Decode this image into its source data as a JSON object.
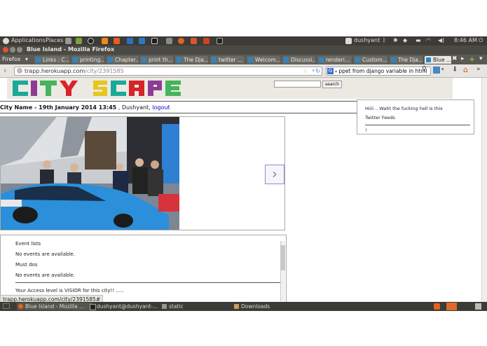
{
  "top_panel": {
    "applications": "Applications",
    "places": "Places",
    "user": "dushyant",
    "time": "8:46 AM"
  },
  "window": {
    "title": "Blue Island - Mozilla Firefox"
  },
  "firefox_menu": "Firefox",
  "tabs": [
    {
      "label": "Links : C..."
    },
    {
      "label": "printing..."
    },
    {
      "label": "Chapter..."
    },
    {
      "label": "print th..."
    },
    {
      "label": "The Dja..."
    },
    {
      "label": "twitter ..."
    },
    {
      "label": "Welcom..."
    },
    {
      "label": "Discussi..."
    },
    {
      "label": "renderi..."
    },
    {
      "label": "Custom..."
    },
    {
      "label": "The Dja..."
    },
    {
      "label": "Blue ..."
    }
  ],
  "nav": {
    "url_domain": "trapp.herokuapp.com",
    "url_path": "/city/2391585",
    "search_engine": "G",
    "search_text": "ppet from django variable in html"
  },
  "site": {
    "logo": "CITY SCAPE",
    "search_button": "search",
    "header_text": "City Name - 19th January 2014 13:45",
    "user_text": ", Dushyant,",
    "logout": "logout"
  },
  "twitter_box": {
    "line1": "Hiiii .. Waht the fucking hell is this",
    "title": "Twitter Feeds",
    "item": "!"
  },
  "events": {
    "event_lists_title": "Event lists",
    "event_empty": "No events are available.",
    "must_dos_title": "Must dos",
    "must_empty": "No events are available.",
    "access_text": "Your Access level is VISIOR for this city!! ....."
  },
  "status_link": "trapp.herokuapp.com/city/2391585#",
  "taskbar": {
    "items": [
      {
        "label": "Blue Island - Mozilla ..."
      },
      {
        "label": "dushyant@dushyant-..."
      },
      {
        "label": "static"
      },
      {
        "label": "Downloads"
      }
    ]
  },
  "colors": {
    "panel": "#3c3b37",
    "link": "#0000cc",
    "logo_teal": "#1aa99a",
    "logo_yellow": "#e8c51b",
    "logo_red": "#d8232a",
    "logo_green": "#46b35e",
    "logo_purple": "#8c3c97"
  }
}
